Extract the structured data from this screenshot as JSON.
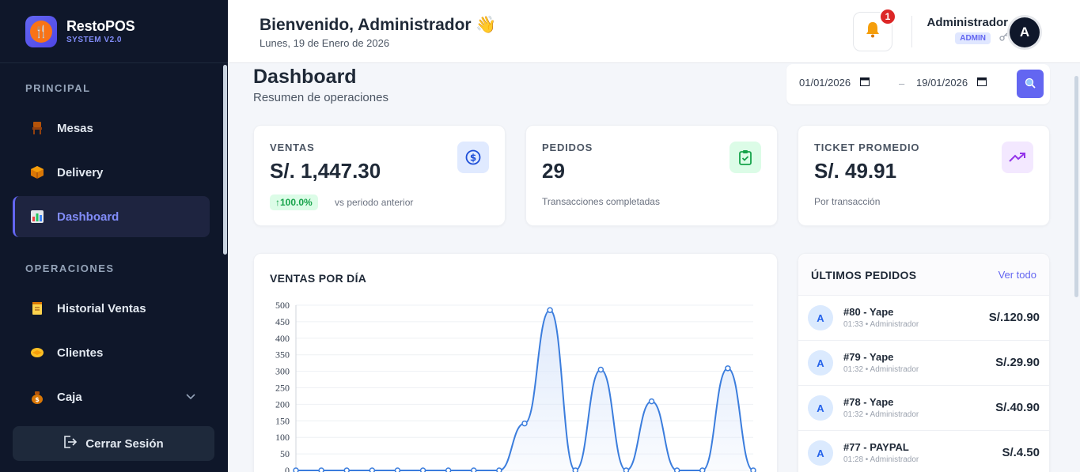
{
  "sidebar": {
    "brand_name": "RestoPOS",
    "brand_sub": "SYSTEM V2.0",
    "section_principal": "PRINCIPAL",
    "section_operaciones": "OPERACIONES",
    "items": [
      {
        "label": "Mesas",
        "icon": "chair-icon"
      },
      {
        "label": "Delivery",
        "icon": "package-icon"
      },
      {
        "label": "Dashboard",
        "icon": "bar-chart-icon",
        "active": true
      },
      {
        "label": "Historial Ventas",
        "icon": "scroll-icon"
      },
      {
        "label": "Clientes",
        "icon": "handshake-icon"
      },
      {
        "label": "Caja",
        "icon": "money-bag-icon"
      }
    ],
    "logout_label": "Cerrar Sesión"
  },
  "header": {
    "welcome": "Bienvenido, Administrador 👋",
    "date": "Lunes, 19 de Enero de 2026",
    "notification_count": "1",
    "user_name": "Administrador",
    "role": "ADMIN",
    "avatar_letter": "A"
  },
  "page": {
    "title": "Dashboard",
    "subtitle": "Resumen de operaciones",
    "date_from": "01/01/2026",
    "date_to": "19/01/2026",
    "date_separator": "–"
  },
  "stats": {
    "ventas_label": "VENTAS",
    "ventas_value": "S/. 1,447.30",
    "ventas_trend": "↑100.0%",
    "ventas_note": "vs periodo anterior",
    "pedidos_label": "PEDIDOS",
    "pedidos_value": "29",
    "pedidos_note": "Transacciones completadas",
    "ticket_label": "TICKET PROMEDIO",
    "ticket_value": "S/. 49.91",
    "ticket_note": "Por transacción"
  },
  "chart": {
    "title": "VENTAS POR DÍA"
  },
  "chart_data": {
    "type": "line",
    "title": "VENTAS POR DÍA",
    "ylim": [
      0,
      500
    ],
    "yticks": [
      0,
      50,
      100,
      150,
      200,
      250,
      300,
      350,
      400,
      450,
      500
    ],
    "values": [
      0,
      0,
      0,
      0,
      0,
      0,
      0,
      0,
      0,
      142,
      485,
      0,
      305,
      0,
      209,
      0,
      0,
      309,
      0
    ],
    "grid": true,
    "colors": {
      "line": "#3b7ddd",
      "fill": "#dbe7fb"
    }
  },
  "orders": {
    "title": "ÚLTIMOS PEDIDOS",
    "link": "Ver todo",
    "rows": [
      {
        "avatar": "A",
        "id": "#80 - Yape",
        "meta": "01:33 • Administrador",
        "amount": "S/.120.90"
      },
      {
        "avatar": "A",
        "id": "#79 - Yape",
        "meta": "01:32 • Administrador",
        "amount": "S/.29.90"
      },
      {
        "avatar": "A",
        "id": "#78 - Yape",
        "meta": "01:32 • Administrador",
        "amount": "S/.40.90"
      },
      {
        "avatar": "A",
        "id": "#77 - PAYPAL",
        "meta": "01:28 • Administrador",
        "amount": "S/.4.50"
      }
    ]
  },
  "colors": {
    "sidebar_bg": "#0f172a",
    "accent": "#6366f1",
    "success": "#16a34a",
    "danger": "#dc2626"
  }
}
